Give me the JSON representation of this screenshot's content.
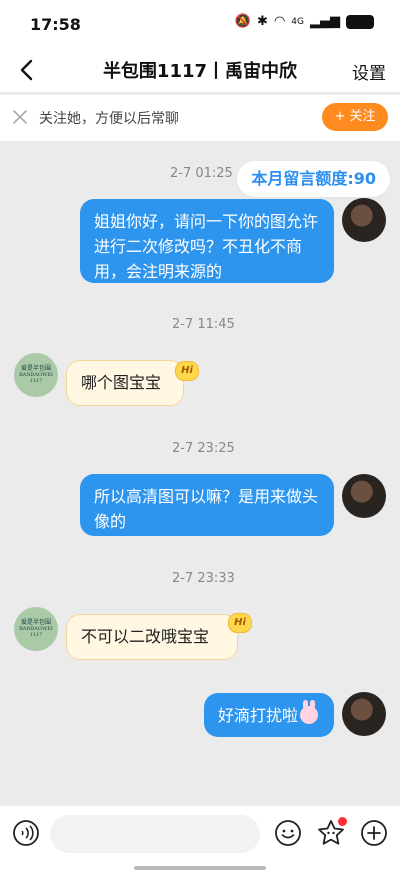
{
  "status_bar": {
    "time": "17:58",
    "network": "4G",
    "battery": "68"
  },
  "nav": {
    "title": "半包围1117丨禹宙中欣",
    "settings_label": "设置"
  },
  "follow_bar": {
    "text": "关注她，方便以后常聊",
    "button_label": "+ 关注"
  },
  "quota": {
    "text": "本月留言额度:90"
  },
  "messages": [
    {
      "time": "2-7 01:25",
      "from": "self",
      "text": "姐姐你好，请问一下你的图允许进行二次修改吗？不丑化不商用，会注明来源的"
    },
    {
      "time": "2-7 11:45",
      "from": "other",
      "text": "哪个图宝宝",
      "badge": "Hi"
    },
    {
      "time": "2-7 23:25",
      "from": "self",
      "text": "所以高清图可以嘛？是用来做头像的"
    },
    {
      "time": "2-7 23:33",
      "from": "other",
      "text": "不可以二改哦宝宝",
      "badge": "Hi"
    },
    {
      "time": "",
      "from": "self",
      "text": "好滴打扰啦",
      "emoji": "bunny-emoji"
    }
  ],
  "other_avatar": {
    "logo_line1": "爱是半包围",
    "logo_line2": "BANBAOWEI",
    "logo_line3": "1117"
  },
  "input": {
    "placeholder": ""
  },
  "icons": [
    "back-icon",
    "close-icon",
    "voice-icon",
    "emoji-icon",
    "sticker-icon",
    "plus-icon"
  ],
  "colors": {
    "accent_blue": "#2e95ef",
    "follow_orange": "#ff8a1f",
    "incoming_bg": "#fff7e2"
  }
}
